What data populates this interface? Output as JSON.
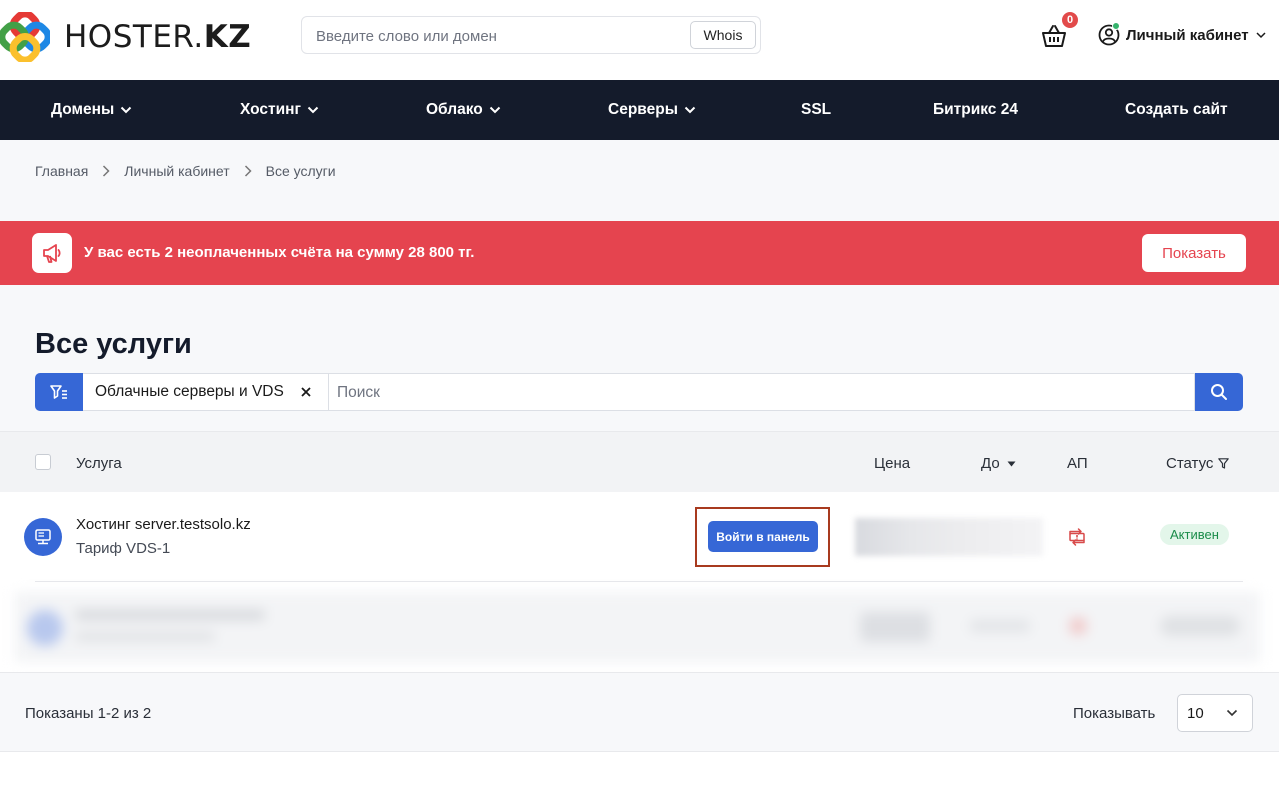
{
  "header": {
    "logo_text_regular": "HOSTER.",
    "logo_text_bold": "KZ",
    "search_placeholder": "Введите слово или домен",
    "whois_label": "Whois",
    "cart_count": "0",
    "account_label": "Личный кабинет"
  },
  "nav": {
    "items": [
      {
        "label": "Домены"
      },
      {
        "label": "Хостинг"
      },
      {
        "label": "Облако"
      },
      {
        "label": "Серверы"
      },
      {
        "label": "SSL"
      },
      {
        "label": "Битрикс 24"
      },
      {
        "label": "Создать сайт"
      }
    ]
  },
  "breadcrumb": {
    "items": [
      "Главная",
      "Личный кабинет",
      "Все услуги"
    ]
  },
  "alert": {
    "text": "У вас есть 2 неоплаченных счёта на сумму 28 800 тг.",
    "button_label": "Показать"
  },
  "page": {
    "title": "Все услуги",
    "filter_chip": "Облачные серверы и VDS",
    "search_placeholder": "Поиск"
  },
  "table": {
    "columns": {
      "service": "Услуга",
      "price": "Цена",
      "until": "До",
      "ap": "АП",
      "status": "Статус"
    },
    "rows": [
      {
        "name": "Хостинг server.testsolo.kz",
        "tariff": "Тариф VDS-1",
        "panel_button": "Войти в панель",
        "status": "Активен"
      }
    ]
  },
  "footer": {
    "shown_text": "Показаны 1-2 из 2",
    "per_page_label": "Показывать",
    "per_page_value": "10"
  },
  "colors": {
    "nav_bg": "#141b2b",
    "accent": "#3667d6",
    "alert": "#e5444f",
    "status_active": "#1a8c49"
  }
}
